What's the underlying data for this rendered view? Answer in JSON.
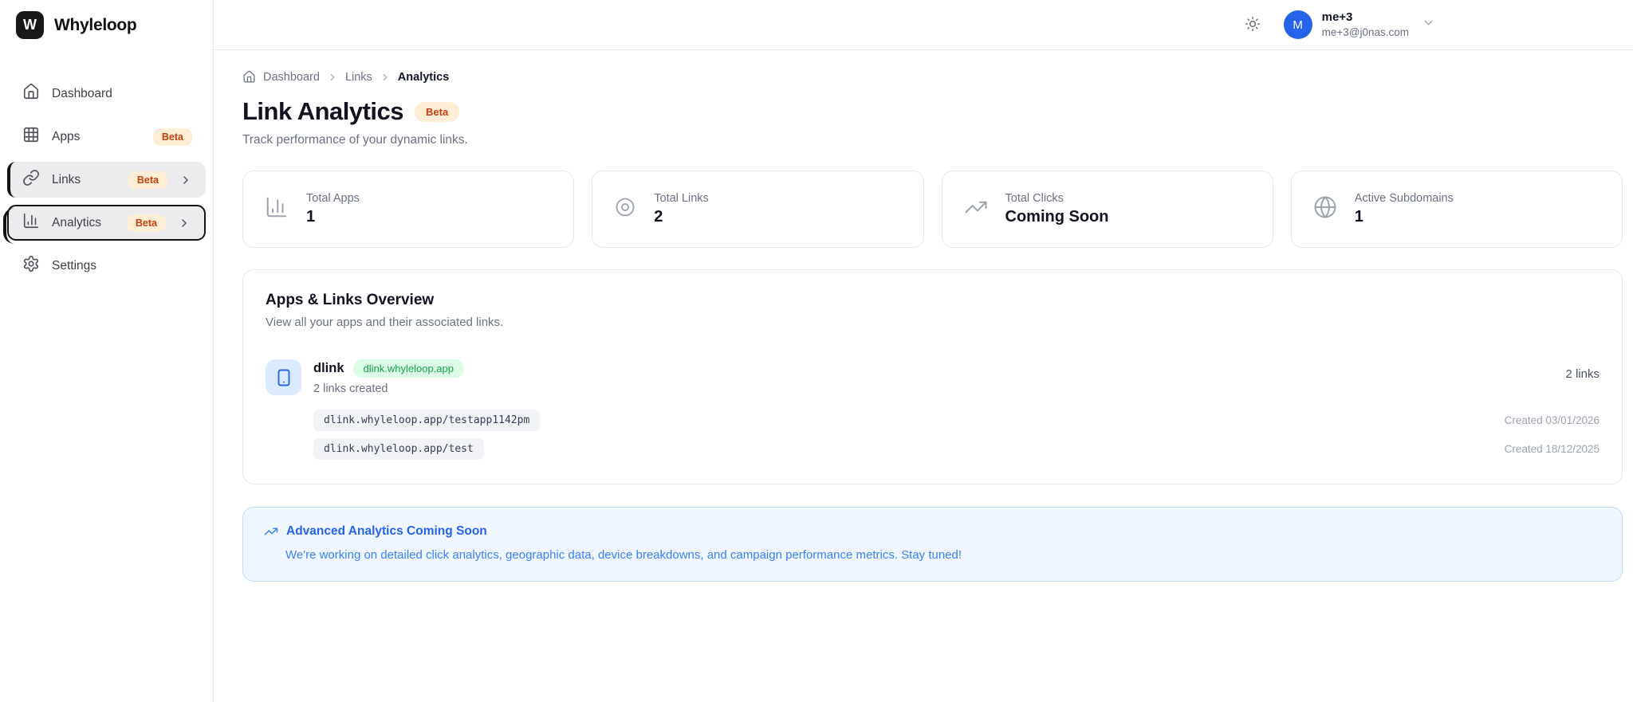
{
  "brand": {
    "logo_letter": "W",
    "name": "Whyleloop"
  },
  "header": {
    "user_name": "me+3",
    "user_email": "me+3@j0nas.com",
    "avatar_letter": "M"
  },
  "sidebar": {
    "items": [
      {
        "label": "Dashboard",
        "icon": "home-icon",
        "badge": ""
      },
      {
        "label": "Apps",
        "icon": "grid-icon",
        "badge": "Beta"
      },
      {
        "label": "Links",
        "icon": "link-icon",
        "badge": "Beta"
      },
      {
        "label": "Analytics",
        "icon": "bar-chart-icon",
        "badge": "Beta",
        "active": true
      },
      {
        "label": "Settings",
        "icon": "gear-icon",
        "badge": ""
      }
    ]
  },
  "breadcrumb": {
    "items": [
      "Dashboard",
      "Links",
      "Analytics"
    ]
  },
  "page": {
    "title": "Link Analytics",
    "badge": "Beta",
    "subtitle": "Track performance of your dynamic links."
  },
  "stats": [
    {
      "label": "Total Apps",
      "value": "1",
      "icon": "bar-chart-icon"
    },
    {
      "label": "Total Links",
      "value": "2",
      "icon": "eye-icon"
    },
    {
      "label": "Total Clicks",
      "value": "Coming Soon",
      "icon": "trending-up-icon"
    },
    {
      "label": "Active Subdomains",
      "value": "1",
      "icon": "globe-icon"
    }
  ],
  "overview": {
    "title": "Apps & Links Overview",
    "subtitle": "View all your apps and their associated links.",
    "apps": [
      {
        "name": "dlink",
        "domain": "dlink.whyleloop.app",
        "links_created": "2 links created",
        "links_count": "2 links",
        "links": [
          {
            "url": "dlink.whyleloop.app/testapp1142pm",
            "created": "Created 03/01/2026"
          },
          {
            "url": "dlink.whyleloop.app/test",
            "created": "Created 18/12/2025"
          }
        ]
      }
    ]
  },
  "banner": {
    "title": "Advanced Analytics Coming Soon",
    "body": "We're working on detailed click analytics, geographic data, device breakdowns, and campaign performance metrics. Stay tuned!"
  },
  "colors": {
    "accent_blue": "#2563eb",
    "beta_badge_bg": "#ffedd5",
    "beta_badge_text": "#c2410c",
    "domain_pill_bg": "#dcfce7",
    "domain_pill_text": "#16a34a",
    "banner_bg": "#eff6ff",
    "banner_border": "#bfdbfe",
    "active_item_border": "#131316"
  }
}
